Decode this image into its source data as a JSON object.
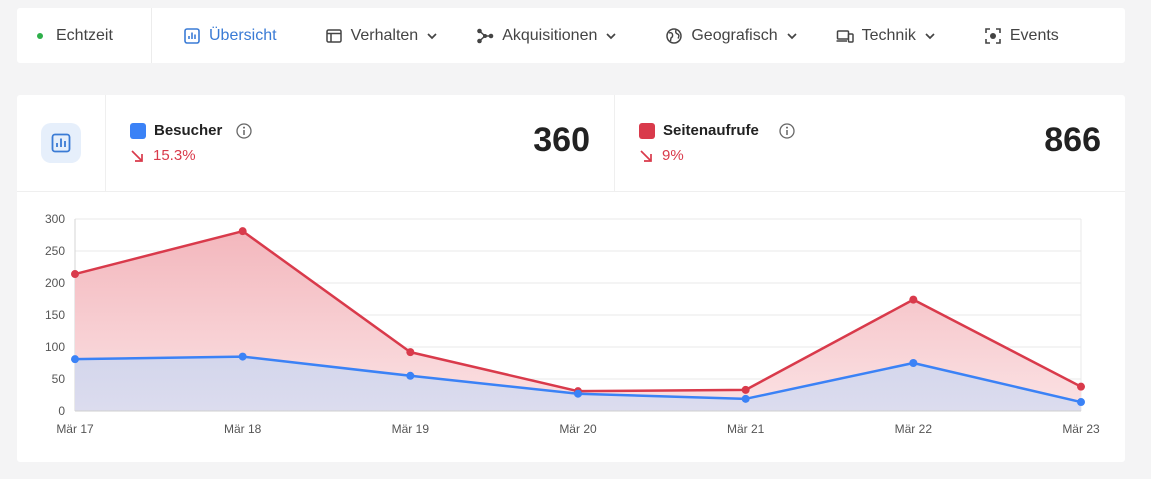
{
  "nav": {
    "items": [
      {
        "label": "Echtzeit",
        "icon": "live-dot-icon"
      },
      {
        "label": "Übersicht",
        "icon": "bar-chart-icon",
        "active": true
      },
      {
        "label": "Verhalten",
        "icon": "window-icon",
        "dropdown": true
      },
      {
        "label": "Akquisitionen",
        "icon": "share-nodes-icon",
        "dropdown": true
      },
      {
        "label": "Geografisch",
        "icon": "globe-icon",
        "dropdown": true
      },
      {
        "label": "Technik",
        "icon": "devices-icon",
        "dropdown": true
      },
      {
        "label": "Events",
        "icon": "focus-icon"
      }
    ]
  },
  "stats": {
    "visitors": {
      "label": "Besucher",
      "trend": "15.3%",
      "value": "360",
      "color": "#3b82f6"
    },
    "pageviews": {
      "label": "Seitenaufrufe",
      "trend": "9%",
      "value": "866",
      "color": "#d93a4b"
    }
  },
  "colors": {
    "accent": "#3a7bd5",
    "visitors": "#3b82f6",
    "pageviews": "#d93a4b",
    "live": "#2eaf4a"
  },
  "chart_data": {
    "type": "area",
    "x": [
      "Mär 17",
      "Mär 18",
      "Mär 19",
      "Mär 20",
      "Mär 21",
      "Mär 22",
      "Mär 23"
    ],
    "series": [
      {
        "name": "Seitenaufrufe",
        "values": [
          214,
          281,
          92,
          31,
          33,
          174,
          38
        ],
        "color": "#d93a4b"
      },
      {
        "name": "Besucher",
        "values": [
          81,
          85,
          55,
          27,
          19,
          75,
          14
        ],
        "color": "#3b82f6"
      }
    ],
    "yticks": [
      0,
      50,
      100,
      150,
      200,
      250,
      300
    ],
    "ylim": [
      0,
      300
    ],
    "grid": true
  }
}
